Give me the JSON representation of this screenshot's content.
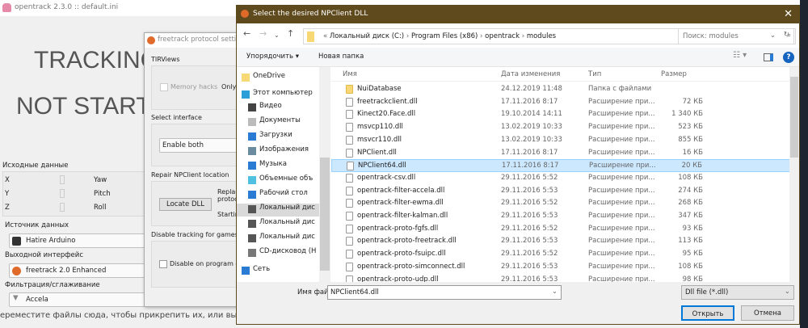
{
  "main": {
    "title": "opentrack 2.3.0 :: default.ini",
    "status_line1": "TRACKING",
    "status_line2": "NOT STARTED",
    "raw_label": "Исходные данные",
    "axes": [
      "X",
      "Y",
      "Z"
    ],
    "rot": [
      "Yaw",
      "Pitch",
      "Roll"
    ],
    "input_label": "Источник данных",
    "input_value": "Hatire Arduino",
    "output_label": "Выходной интерфейс",
    "output_value": "freetrack 2.0 Enhanced",
    "filter_label": "Фильтрация/сглаживание",
    "filter_value": "Accela",
    "background_text": "ереместите файлы сюда, чтобы прикрепить их, или выбрать"
  },
  "freetrack": {
    "title": "freetrack protocol settings",
    "tirviews": "TIRViews",
    "memory_hacks": "Memory hacks",
    "only": "Only f",
    "select_interface": "Select interface",
    "interface_value": "Enable both",
    "repair": "Repair NPClient location",
    "locate": "Locate DLL",
    "replace": "Replac",
    "protocol": "protoc",
    "starting": "Startin",
    "disable_group": "Disable tracking for games on",
    "disable_exit": "Disable on program exi"
  },
  "dialog": {
    "title": "Select the desired NPClient DLL",
    "breadcrumb": [
      "Локальный диск (C:)",
      "Program Files (x86)",
      "opentrack",
      "modules"
    ],
    "search_placeholder": "Поиск: modules",
    "organize": "Упорядочить ▾",
    "new_folder": "Новая папка",
    "nav": [
      "OneDrive",
      "Этот компьютер",
      "Видео",
      "Документы",
      "Загрузки",
      "Изображения",
      "Музыка",
      "Объемные объ",
      "Рабочий стол",
      "Локальный дис",
      "Локальный дис",
      "Локальный дис",
      "CD-дисковод (H",
      "Сеть"
    ],
    "columns": {
      "name": "Имя",
      "date": "Дата изменения",
      "type": "Тип",
      "size": "Размер"
    },
    "files": [
      {
        "name": "NuiDatabase",
        "date": "24.12.2019 11:48",
        "type": "Папка с файлами",
        "size": "",
        "folder": true
      },
      {
        "name": "freetrackclient.dll",
        "date": "17.11.2016 8:17",
        "type": "Расширение при...",
        "size": "72 КБ"
      },
      {
        "name": "Kinect20.Face.dll",
        "date": "19.10.2014 14:11",
        "type": "Расширение при...",
        "size": "1 340 КБ"
      },
      {
        "name": "msvcp110.dll",
        "date": "13.02.2019 10:33",
        "type": "Расширение при...",
        "size": "523 КБ"
      },
      {
        "name": "msvcr110.dll",
        "date": "13.02.2019 10:33",
        "type": "Расширение при...",
        "size": "855 КБ"
      },
      {
        "name": "NPClient.dll",
        "date": "17.11.2016 8:17",
        "type": "Расширение при...",
        "size": "16 КБ"
      },
      {
        "name": "NPClient64.dll",
        "date": "17.11.2016 8:17",
        "type": "Расширение при...",
        "size": "20 КБ",
        "selected": true
      },
      {
        "name": "opentrack-csv.dll",
        "date": "29.11.2016 5:52",
        "type": "Расширение при...",
        "size": "108 КБ"
      },
      {
        "name": "opentrack-filter-accela.dll",
        "date": "29.11.2016 5:53",
        "type": "Расширение при...",
        "size": "274 КБ"
      },
      {
        "name": "opentrack-filter-ewma.dll",
        "date": "29.11.2016 5:52",
        "type": "Расширение при...",
        "size": "268 КБ"
      },
      {
        "name": "opentrack-filter-kalman.dll",
        "date": "29.11.2016 5:53",
        "type": "Расширение при...",
        "size": "347 КБ"
      },
      {
        "name": "opentrack-proto-fgfs.dll",
        "date": "29.11.2016 5:52",
        "type": "Расширение при...",
        "size": "93 КБ"
      },
      {
        "name": "opentrack-proto-freetrack.dll",
        "date": "29.11.2016 5:53",
        "type": "Расширение при...",
        "size": "113 КБ"
      },
      {
        "name": "opentrack-proto-fsuipc.dll",
        "date": "29.11.2016 5:52",
        "type": "Расширение при...",
        "size": "95 КБ"
      },
      {
        "name": "opentrack-proto-simconnect.dll",
        "date": "29.11.2016 5:53",
        "type": "Расширение при...",
        "size": "108 КБ"
      },
      {
        "name": "opentrack-proto-udp.dll",
        "date": "29.11.2016 5:53",
        "type": "Расширение при...",
        "size": "98 КБ"
      }
    ],
    "filename_label": "Имя файла:",
    "filename_value": "NPClient64.dll",
    "filetype": "Dll file (*.dll)",
    "open": "Открыть",
    "cancel": "Отмена"
  }
}
